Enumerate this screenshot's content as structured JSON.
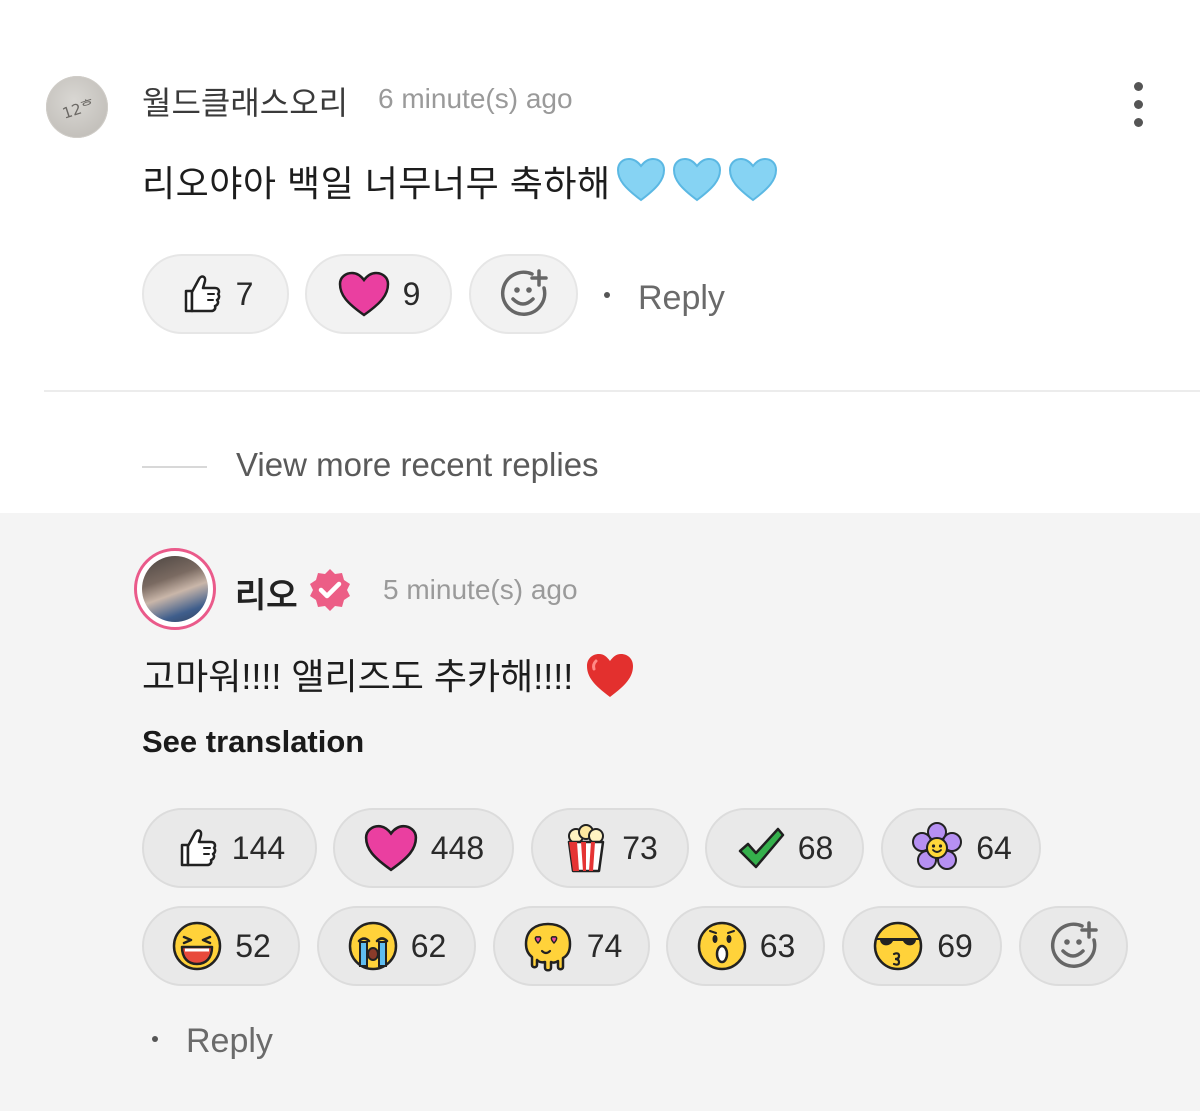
{
  "comment": {
    "username": "월드클래스오리",
    "time": "6 minute(s) ago",
    "text": "리오야아 백일 너무너무 축하해",
    "reactions": [
      {
        "icon": "thumbs-up-icon",
        "count": "7"
      },
      {
        "icon": "pink-heart-icon",
        "count": "9"
      }
    ],
    "reply_label": "Reply"
  },
  "view_more_replies": "View more recent replies",
  "reply": {
    "username": "리오",
    "time": "5 minute(s) ago",
    "text": "고마워!!!! 앨리즈도 추카해!!!!",
    "see_translation": "See translation",
    "reactions_row1": [
      {
        "icon": "thumbs-up-icon",
        "count": "144"
      },
      {
        "icon": "pink-heart-icon",
        "count": "448"
      },
      {
        "icon": "popcorn-icon",
        "count": "73"
      },
      {
        "icon": "check-icon",
        "count": "68"
      },
      {
        "icon": "flower-icon",
        "count": "64"
      }
    ],
    "reactions_row2": [
      {
        "icon": "laughing-face-icon",
        "count": "52"
      },
      {
        "icon": "crying-face-icon",
        "count": "62"
      },
      {
        "icon": "melting-love-face-icon",
        "count": "74"
      },
      {
        "icon": "surprised-face-icon",
        "count": "63"
      },
      {
        "icon": "sunglasses-kiss-face-icon",
        "count": "69"
      }
    ],
    "reply_label": "Reply"
  },
  "colors": {
    "heart_pink": "#e8399c",
    "verified_badge": "#ec5e86",
    "blue_heart": "#7fd0f2",
    "red_heart": "#e32b2b"
  }
}
